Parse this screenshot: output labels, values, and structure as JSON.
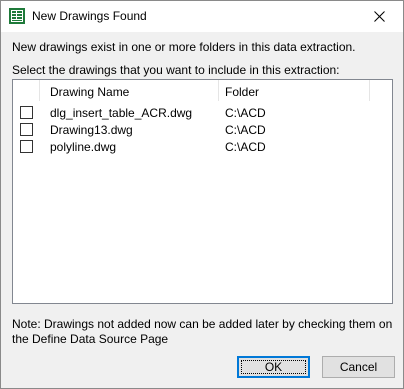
{
  "window": {
    "title": "New Drawings Found"
  },
  "messages": {
    "line1": "New drawings exist in one or more folders in this data extraction.",
    "line2": "Select the drawings that you want to include in this extraction:"
  },
  "table": {
    "columns": [
      "Drawing Name",
      "Folder"
    ],
    "rows": [
      {
        "name": "dlg_insert_table_ACR.dwg",
        "folder": "C:\\ACD",
        "checked": false
      },
      {
        "name": "Drawing13.dwg",
        "folder": "C:\\ACD",
        "checked": false
      },
      {
        "name": "polyline.dwg",
        "folder": "C:\\ACD",
        "checked": false
      }
    ]
  },
  "note": "Note: Drawings not added now can be added later by checking them on the Define Data Source Page",
  "buttons": {
    "ok_label": "OK",
    "cancel_label": "Cancel"
  },
  "colors": {
    "accent": "#0078d7",
    "dialog_bg": "#f0f0f0"
  }
}
